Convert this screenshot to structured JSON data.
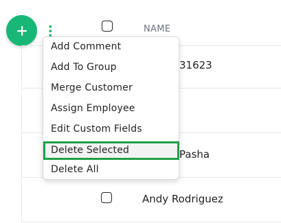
{
  "toolbar": {
    "add_icon": "plus-icon",
    "more_icon": "kebab-vertical-icon",
    "accent_color": "#18b777"
  },
  "table": {
    "columns": [
      "NAME"
    ],
    "rows": [
      {
        "name": "31623"
      },
      {
        "name": "Pasha"
      },
      {
        "name": "Andy Rodriguez"
      }
    ]
  },
  "menu": {
    "items": [
      {
        "label": "Add Comment"
      },
      {
        "label": "Add To Group"
      },
      {
        "label": "Merge Customer"
      },
      {
        "label": "Assign Employee"
      },
      {
        "label": "Edit Custom Fields"
      },
      {
        "label": "Delete Selected"
      },
      {
        "label": "Delete All"
      }
    ],
    "highlight_color": "#1fa04a"
  }
}
